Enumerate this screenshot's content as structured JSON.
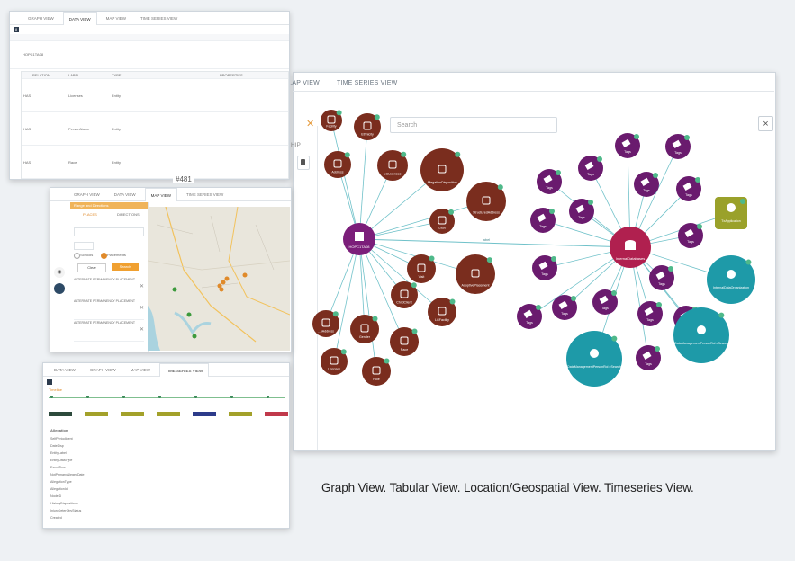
{
  "caption": "Graph View. Tabular View. Location/Geospatial View. Timeseries View.",
  "graph_view": {
    "tabs": [
      "...AP VIEW",
      "TIME SERIES VIEW"
    ],
    "search_placeholder": "Search",
    "close_label": "×",
    "side_label": "HIP",
    "collapse_icon": "x-icon",
    "hub_left_label": "HOPC1TA08",
    "hub_right_label": "InternalDatabases",
    "left_nodes": [
      "Facility",
      "Ethnicity",
      "Address",
      "LGLicenses",
      "AllegationDisposition",
      "StructuredAddress",
      "Case",
      "Visit",
      "AdoptivePlacement",
      "ChildClient",
      "LGFacility",
      "Gender",
      "Race",
      "Role",
      "Licenses",
      "...yAddress"
    ],
    "tag_label": "Tags",
    "right_big_nodes": [
      "TxApplication",
      "InternalDataOrganization",
      "DataManagementPersonRol eSearch",
      "DataManagementPersonRol eSearch"
    ],
    "edge_label": "label",
    "colors": {
      "hub_left": "#7b1e7a",
      "hub_right": "#b0204f",
      "brown": "#7a2d1e",
      "purple": "#6a1b6e",
      "teal": "#1e9aa8",
      "olive": "#9aa12a",
      "edge": "#6fc1c9",
      "badge": "#4fb98a"
    }
  },
  "tabular_view": {
    "tabs": [
      "GRAPH VIEW",
      "DATA VIEW",
      "MAP VIEW",
      "TIME SERIES VIEW"
    ],
    "badge": "8",
    "row_label": "HOPC1TA08",
    "sub_headers": [
      "RELATION",
      "LABEL",
      "TYPE",
      "PROPERTIES"
    ],
    "rows": [
      {
        "relation": "HAS",
        "label": "Licenses",
        "type": "Entity"
      },
      {
        "relation": "HAS",
        "label": "PersonName",
        "type": "Entity"
      },
      {
        "relation": "HAS",
        "label": "Race",
        "type": "Entity"
      }
    ]
  },
  "map_view": {
    "tabs": [
      "GRAPH VIEW",
      "DATA VIEW",
      "MAP VIEW",
      "TIME SERIES VIEW"
    ],
    "title": "Range and Directions",
    "sub_tabs": [
      "PLACES",
      "DIRECTIONS"
    ],
    "radio_options": [
      "Schools",
      "Placements"
    ],
    "btn_clear": "Clear",
    "btn_search": "Search",
    "list_label": "ALTERNATE PERMANENCY PLACEMENT",
    "counter": "#481"
  },
  "timeseries_view": {
    "tabs": [
      "DATA VIEW",
      "GRAPH VIEW",
      "MAP VIEW",
      "TIME SERIES VIEW"
    ],
    "section": "Timeline",
    "detail_title": "Allegation",
    "detail_fields": [
      "SelfPeriodIdent",
      "DateDisp",
      "EntityLabel",
      "EntityDataType",
      "EventTime",
      "NotPrimaryAllegedDate",
      "AllegationType",
      "AllegationId",
      "NodeID",
      "HistoryDispositions",
      "InjuryDeterObvStatus",
      "Created"
    ]
  }
}
